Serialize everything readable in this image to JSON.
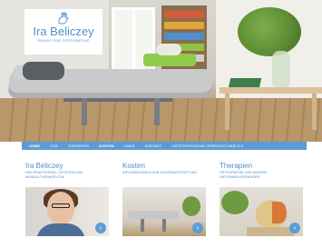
{
  "brand": {
    "name": "Ira Beliczey",
    "tagline": "PRAXIS FÜR OSTEOPATHIE",
    "icon": "hand-logo-icon",
    "color": "#4f8fd0"
  },
  "nav": {
    "items": [
      {
        "label": "HOME",
        "active": true
      },
      {
        "label": "VITA",
        "active": false
      },
      {
        "label": "THERAPIEN",
        "active": false
      },
      {
        "label": "KOSTEN",
        "active": true
      },
      {
        "label": "LINKS",
        "active": false
      },
      {
        "label": "KONTAKT",
        "active": false
      },
      {
        "label": "OSTEOPATHISCHE SPRECHSTUNDE E.V.",
        "active": false
      }
    ],
    "color": "#5b9cd6"
  },
  "columns": [
    {
      "title": "Ira Beliczey",
      "subtitle": "HEILPRAKTIKERIN, OSTEOPATHIN, MANUALTHERAPEUTIN",
      "arrow": "›"
    },
    {
      "title": "Kosten",
      "subtitle": "INFORMATIONEN ZUR KOSTENERSTATTUNG",
      "arrow": "›"
    },
    {
      "title": "Therapien",
      "subtitle": "OSTEOPATHIE UND ANDERE NATURHEILVERFAHREN",
      "arrow": "›"
    }
  ]
}
